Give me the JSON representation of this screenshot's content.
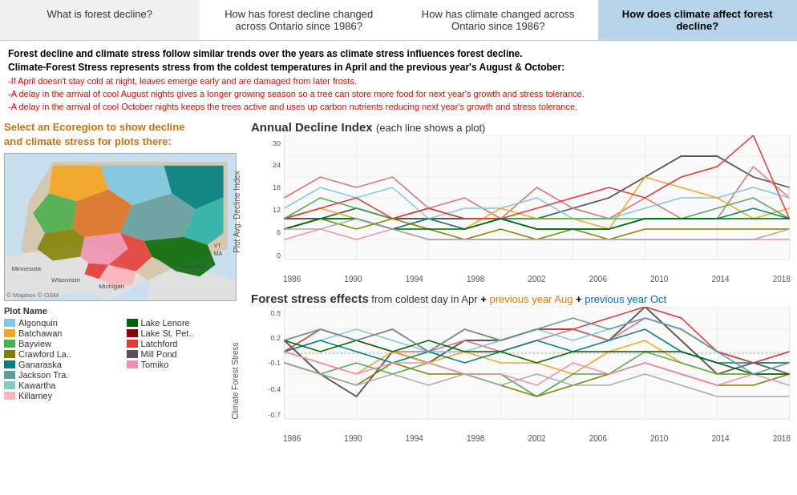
{
  "tabs": [
    {
      "label": "What is forest decline?",
      "active": false
    },
    {
      "label": "How has forest decline changed across Ontario since 1986?",
      "active": false
    },
    {
      "label": "How has climate changed across Ontario since 1986?",
      "active": false
    },
    {
      "label": "How does climate affect forest decline?",
      "active": true
    }
  ],
  "info": {
    "line1": "Forest decline and climate stress follow similar trends over the years as climate stress influences forest decline.",
    "line2": "Climate-Forest Stress represents stress from the coldest temperatures in April and the previous year's August & October:",
    "bullet1": "-If April doesn't stay cold at night, leaves emerge early and are damaged from later frosts.",
    "bullet2": "-A delay in the arrival of cool August nights gives a longer growing season so a tree can store more food for next year's growth and stress tolerance.",
    "bullet3": "-A delay in the arrival of cool October nights keeps the trees active and uses up carbon nutrients reducing next year's growth and stress tolerance."
  },
  "select_label": "Select an Ecoregion to show decline\nand climate stress for plots there:",
  "chart1": {
    "title": "Annual Decline Index",
    "subtitle": " (each line shows a plot)",
    "y_label": "Plot Avg. Decline Index",
    "y_ticks": [
      "30",
      "24",
      "18",
      "12",
      "6",
      "0"
    ],
    "x_ticks": [
      "1986",
      "1990",
      "1994",
      "1998",
      "2002",
      "2006",
      "2010",
      "2014",
      "2018"
    ]
  },
  "chart2": {
    "title": "Forest stress effects",
    "subtitle": " from coldest day in Apr + previous year Aug + previous year Oct",
    "y_label": "Climate Forest Stress",
    "y_ticks": [
      "0.5",
      "0.2",
      "-0.1",
      "-0.4",
      "-0.7"
    ],
    "x_ticks": [
      "1986",
      "1990",
      "1994",
      "1998",
      "2002",
      "2006",
      "2010",
      "2014",
      "2018"
    ]
  },
  "legend": {
    "title": "Plot Name",
    "items": [
      {
        "label": "Algonquin",
        "color": "#7ec8e3"
      },
      {
        "label": "Lake Lenore",
        "color": "#006400"
      },
      {
        "label": "Batchawan",
        "color": "#f5a623"
      },
      {
        "label": "Lake St. Pet..",
        "color": "#8b0000"
      },
      {
        "label": "Bayview",
        "color": "#4caf50"
      },
      {
        "label": "Latchford",
        "color": "#e53935"
      },
      {
        "label": "Crawford La..",
        "color": "#808000"
      },
      {
        "label": "Mill Pond",
        "color": "#555555"
      },
      {
        "label": "Ganaraska",
        "color": "#008080"
      },
      {
        "label": "Tomiko",
        "color": "#f48fb1"
      },
      {
        "label": "Jackson Tra.",
        "color": "#5f9ea0"
      },
      {
        "label": "",
        "color": ""
      },
      {
        "label": "Kawartha",
        "color": "#80cbc4"
      },
      {
        "label": "",
        "color": ""
      },
      {
        "label": "Killarney",
        "color": "#ffb3ba"
      },
      {
        "label": "",
        "color": ""
      }
    ]
  },
  "map": {
    "labels": [
      "Minnesota",
      "Wisconsin",
      "Michigan",
      "New York",
      "VT",
      "MA"
    ],
    "copyright": "© Mapbox © OSM"
  }
}
